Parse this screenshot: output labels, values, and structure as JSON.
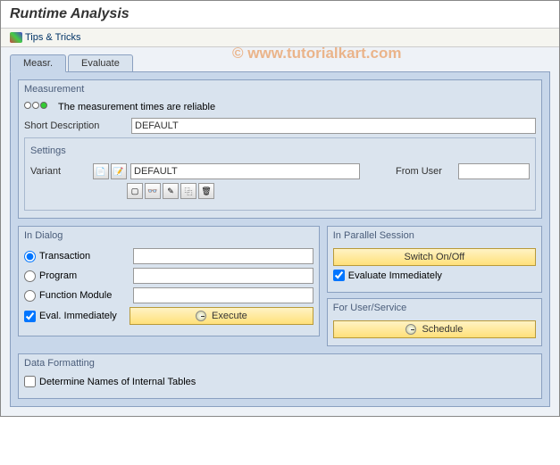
{
  "title": "Runtime Analysis",
  "toolbar": {
    "tips": "Tips & Tricks"
  },
  "tabs": {
    "measr": "Measr.",
    "evaluate": "Evaluate"
  },
  "measurement": {
    "title": "Measurement",
    "status_text": "The measurement times are reliable",
    "short_desc_label": "Short Description",
    "short_desc_value": "DEFAULT"
  },
  "settings": {
    "title": "Settings",
    "variant_label": "Variant",
    "variant_value": "DEFAULT",
    "from_user_label": "From User",
    "from_user_value": ""
  },
  "dialog": {
    "title": "In Dialog",
    "transaction": "Transaction",
    "program": "Program",
    "function_module": "Function Module",
    "eval_immediately": "Eval. Immediately",
    "execute": "Execute"
  },
  "parallel": {
    "title": "In Parallel Session",
    "switch": "Switch On/Off",
    "eval_immediately": "Evaluate Immediately"
  },
  "user_service": {
    "title": "For User/Service",
    "schedule": "Schedule"
  },
  "formatting": {
    "title": "Data Formatting",
    "determine": "Determine Names of Internal Tables"
  },
  "watermark": "© www.tutorialkart.com"
}
